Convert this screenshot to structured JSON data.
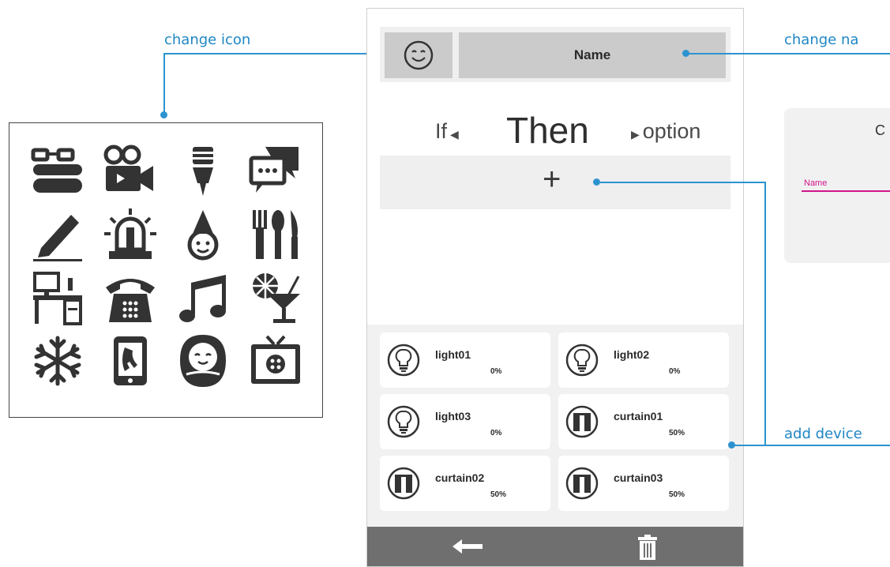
{
  "annotations": {
    "change_icon": "change icon",
    "change_name": "change na",
    "add_device": "add device"
  },
  "icon_grid": [
    "books-glasses-icon",
    "video-camera-icon",
    "microphone-icon",
    "chat-bubbles-icon",
    "pencil-icon",
    "siren-icon",
    "party-hat-icon",
    "cutlery-icon",
    "desk-computer-icon",
    "telephone-icon",
    "music-note-icon",
    "cocktail-icon",
    "snowflake-icon",
    "smartphone-icon",
    "baby-icon",
    "television-icon"
  ],
  "scene": {
    "name_label": "Name",
    "if_label": "If",
    "then_label": "Then",
    "option_label": "option",
    "add_symbol": "+"
  },
  "devices": [
    {
      "name": "light01",
      "value": "0%",
      "icon": "bulb-icon"
    },
    {
      "name": "light02",
      "value": "0%",
      "icon": "bulb-icon"
    },
    {
      "name": "light03",
      "value": "0%",
      "icon": "bulb-icon"
    },
    {
      "name": "curtain01",
      "value": "50%",
      "icon": "curtain-icon"
    },
    {
      "name": "curtain02",
      "value": "50%",
      "icon": "curtain-icon"
    },
    {
      "name": "curtain03",
      "value": "50%",
      "icon": "curtain-icon"
    }
  ],
  "right_panel": {
    "title_partial": "C",
    "name_field_label": "Name"
  },
  "colors": {
    "annotation_blue": "#2d93cf",
    "bar_gray": "#6f6f6f",
    "name_underline": "#d0158c"
  }
}
